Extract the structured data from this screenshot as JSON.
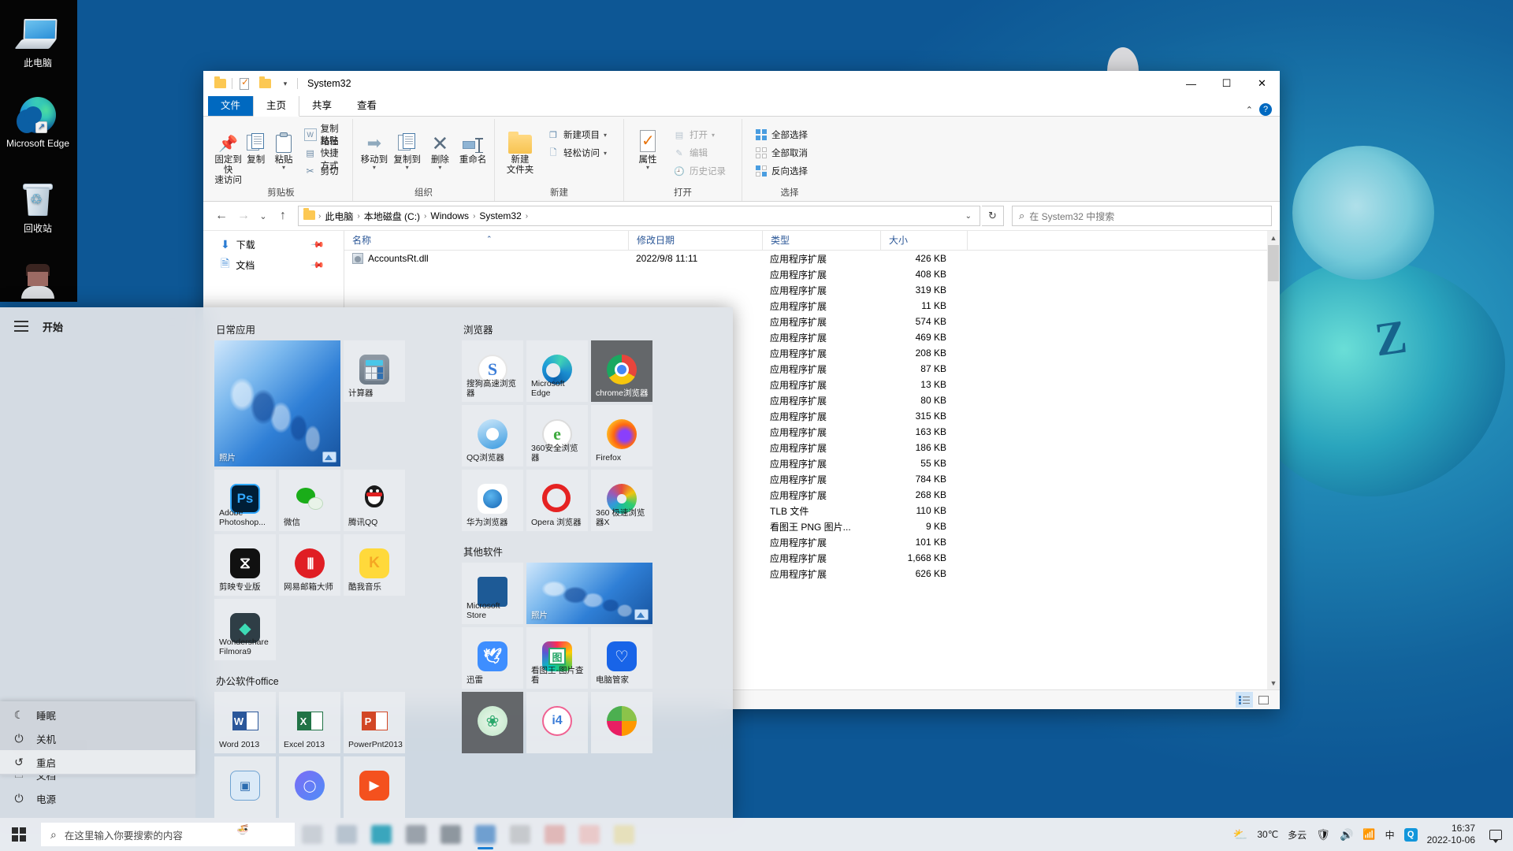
{
  "desktop": {
    "icons": [
      {
        "label": "此电脑",
        "icon": "this-pc-icon"
      },
      {
        "label": "Microsoft Edge",
        "icon": "edge-icon"
      },
      {
        "label": "回收站",
        "icon": "recycle-bin-icon"
      },
      {
        "label": "",
        "icon": "user-avatar-icon"
      }
    ]
  },
  "explorer": {
    "title": "System32",
    "quick_access": [
      "folder-icon",
      "properties-icon",
      "new-folder-icon",
      "customize-caret-icon"
    ],
    "window_buttons": {
      "minimize": "—",
      "maximize": "☐",
      "close": "✕"
    },
    "tabs": [
      {
        "label": "文件",
        "kind": "file"
      },
      {
        "label": "主页",
        "kind": "active"
      },
      {
        "label": "共享",
        "kind": "normal"
      },
      {
        "label": "查看",
        "kind": "normal"
      }
    ],
    "ribbon_collapse": "⌃",
    "help": "?",
    "ribbon": {
      "groups": [
        {
          "label": "剪贴板",
          "big": [
            {
              "label": "固定到快\n速访问",
              "icon": "pin-icon",
              "caret": false
            },
            {
              "label": "复制",
              "icon": "copy-icon",
              "caret": false
            },
            {
              "label": "粘贴",
              "icon": "paste-icon",
              "caret": true
            }
          ],
          "small": [
            {
              "label": "复制路径",
              "icon": "copy-path-icon",
              "dim": false
            },
            {
              "label": "粘贴快捷方式",
              "icon": "paste-shortcut-icon",
              "dim": false
            },
            {
              "label": "剪切",
              "icon": "cut-icon",
              "dim": false
            }
          ]
        },
        {
          "label": "组织",
          "big": [
            {
              "label": "移动到",
              "icon": "move-to-icon",
              "caret": true
            },
            {
              "label": "复制到",
              "icon": "copy-to-icon",
              "caret": true
            },
            {
              "label": "删除",
              "icon": "delete-icon",
              "caret": true
            },
            {
              "label": "重命名",
              "icon": "rename-icon",
              "caret": false
            }
          ],
          "small": []
        },
        {
          "label": "新建",
          "big": [
            {
              "label": "新建\n文件夹",
              "icon": "new-folder-icon",
              "caret": false
            }
          ],
          "small": [
            {
              "label": "新建项目",
              "icon": "new-item-icon",
              "dim": false,
              "caret": true
            },
            {
              "label": "轻松访问",
              "icon": "easy-access-icon",
              "dim": false,
              "caret": true
            }
          ]
        },
        {
          "label": "打开",
          "big": [
            {
              "label": "属性",
              "icon": "properties-icon",
              "caret": true
            }
          ],
          "small": [
            {
              "label": "打开",
              "icon": "open-icon",
              "dim": true,
              "caret": true
            },
            {
              "label": "编辑",
              "icon": "edit-icon",
              "dim": true
            },
            {
              "label": "历史记录",
              "icon": "history-icon",
              "dim": true
            }
          ]
        },
        {
          "label": "选择",
          "big": [],
          "small": [
            {
              "label": "全部选择",
              "icon": "select-all-icon",
              "dim": false
            },
            {
              "label": "全部取消",
              "icon": "select-none-icon",
              "dim": false
            },
            {
              "label": "反向选择",
              "icon": "invert-selection-icon",
              "dim": false
            }
          ]
        }
      ]
    },
    "address": {
      "back": "←",
      "forward": "→",
      "recent": "⌄",
      "up": "↑",
      "crumbs": [
        "此电脑",
        "本地磁盘 (C:)",
        "Windows",
        "System32"
      ],
      "dropdown": "⌄",
      "refresh": "↻"
    },
    "search": {
      "placeholder": "在 System32 中搜索",
      "icon": "search-icon"
    },
    "nav_items": [
      {
        "label": "下载",
        "icon": "downloads-icon",
        "pinned": true
      },
      {
        "label": "文档",
        "icon": "documents-icon",
        "pinned": true
      }
    ],
    "columns": [
      "名称",
      "修改日期",
      "类型",
      "大小"
    ],
    "sort_column": "名称",
    "rows": [
      {
        "name": "AccountsRt.dll",
        "date": "2022/9/8 11:11",
        "type": "应用程序扩展",
        "size": "426 KB"
      },
      {
        "name": "",
        "date": "",
        "type": "应用程序扩展",
        "size": "408 KB"
      },
      {
        "name": "",
        "date": "",
        "type": "应用程序扩展",
        "size": "319 KB"
      },
      {
        "name": "",
        "date": "",
        "type": "应用程序扩展",
        "size": "11 KB"
      },
      {
        "name": "",
        "date": "",
        "type": "应用程序扩展",
        "size": "574 KB"
      },
      {
        "name": "",
        "date": "",
        "type": "应用程序扩展",
        "size": "469 KB"
      },
      {
        "name": "",
        "date": "",
        "type": "应用程序扩展",
        "size": "208 KB"
      },
      {
        "name": "",
        "date": "",
        "type": "应用程序扩展",
        "size": "87 KB"
      },
      {
        "name": "",
        "date": "",
        "type": "应用程序扩展",
        "size": "13 KB"
      },
      {
        "name": "",
        "date": "",
        "type": "应用程序扩展",
        "size": "80 KB"
      },
      {
        "name": "",
        "date": "",
        "type": "应用程序扩展",
        "size": "315 KB"
      },
      {
        "name": "",
        "date": "",
        "type": "应用程序扩展",
        "size": "163 KB"
      },
      {
        "name": "",
        "date": "",
        "type": "应用程序扩展",
        "size": "186 KB"
      },
      {
        "name": "",
        "date": "",
        "type": "应用程序扩展",
        "size": "55 KB"
      },
      {
        "name": "",
        "date": "",
        "type": "应用程序扩展",
        "size": "784 KB"
      },
      {
        "name": "",
        "date": "",
        "type": "应用程序扩展",
        "size": "268 KB"
      },
      {
        "name": "",
        "date": "",
        "type": "TLB 文件",
        "size": "110 KB"
      },
      {
        "name": "",
        "date": "",
        "type": "看图王 PNG 图片...",
        "size": "9 KB"
      },
      {
        "name": "",
        "date": "",
        "type": "应用程序扩展",
        "size": "101 KB"
      },
      {
        "name": "",
        "date": "",
        "type": "应用程序扩展",
        "size": "1,668 KB"
      },
      {
        "name": "",
        "date": "",
        "type": "应用程序扩展",
        "size": "626 KB"
      }
    ],
    "view_buttons": [
      {
        "name": "details-view",
        "active": true
      },
      {
        "name": "large-icons-view",
        "active": false
      }
    ]
  },
  "start_menu": {
    "start_label": "开始",
    "hamburger": "hamburger-icon",
    "links": [
      {
        "label": "文档",
        "icon": "document-icon"
      },
      {
        "label": "电源",
        "icon": "power-icon"
      }
    ],
    "power_flyout": [
      {
        "label": "睡眠",
        "icon": "sleep-moon-icon",
        "highlight": false
      },
      {
        "label": "关机",
        "icon": "shutdown-icon",
        "highlight": false
      },
      {
        "label": "重启",
        "icon": "restart-icon",
        "highlight": true
      }
    ],
    "groups": [
      {
        "title": "日常应用",
        "tiles": [
          {
            "label": "照片",
            "size": "wide",
            "style": "photo",
            "icon": "photos-icon"
          },
          {
            "label": "计算器",
            "size": "small",
            "style": "light",
            "icon": "calculator-icon"
          },
          {
            "label": "Adobe Photoshop...",
            "size": "small",
            "style": "light",
            "icon": "photoshop-icon"
          },
          {
            "label": "微信",
            "size": "small",
            "style": "light",
            "icon": "wechat-icon"
          },
          {
            "label": "腾讯QQ",
            "size": "small",
            "style": "light",
            "icon": "qq-icon"
          },
          {
            "label": "剪映专业版",
            "size": "small",
            "style": "light",
            "icon": "jianying-icon"
          },
          {
            "label": "网易邮箱大师",
            "size": "small",
            "style": "light",
            "icon": "netease-mail-icon"
          },
          {
            "label": "酷我音乐",
            "size": "small",
            "style": "light",
            "icon": "kuwo-music-icon"
          },
          {
            "label": "Wondershare Filmora9",
            "size": "small",
            "style": "light",
            "icon": "filmora-icon"
          }
        ]
      },
      {
        "title": "办公软件office",
        "tiles": [
          {
            "label": "Word 2013",
            "size": "small",
            "style": "light",
            "icon": "word-icon"
          },
          {
            "label": "Excel 2013",
            "size": "small",
            "style": "light",
            "icon": "excel-icon"
          },
          {
            "label": "PowerPnt2013",
            "size": "small",
            "style": "light",
            "icon": "powerpoint-icon"
          },
          {
            "label": "",
            "size": "small",
            "style": "light",
            "icon": "publisher-icon"
          },
          {
            "label": "",
            "size": "small",
            "style": "light",
            "icon": "qq-browser-blue-icon"
          },
          {
            "label": "",
            "size": "small",
            "style": "light",
            "icon": "orange-media-icon"
          }
        ]
      },
      {
        "title": "浏览器",
        "tiles": [
          {
            "label": "搜狗高速浏览器",
            "size": "small",
            "style": "light",
            "icon": "sogou-browser-icon"
          },
          {
            "label": "Microsoft Edge",
            "size": "small",
            "style": "light",
            "icon": "edge-icon"
          },
          {
            "label": "chrome浏览器",
            "size": "small",
            "style": "dark",
            "icon": "chrome-icon"
          },
          {
            "label": "QQ浏览器",
            "size": "small",
            "style": "light",
            "icon": "qq-browser-icon"
          },
          {
            "label": "360安全浏览器",
            "size": "small",
            "style": "light",
            "icon": "360-browser-icon"
          },
          {
            "label": "Firefox",
            "size": "small",
            "style": "light",
            "icon": "firefox-icon"
          },
          {
            "label": "华为浏览器",
            "size": "small",
            "style": "light",
            "icon": "huawei-browser-icon"
          },
          {
            "label": "Opera 浏览器",
            "size": "small",
            "style": "light",
            "icon": "opera-icon"
          },
          {
            "label": "360 极速浏览器X",
            "size": "small",
            "style": "light",
            "icon": "360-speed-browser-icon"
          }
        ]
      },
      {
        "title": "其他软件",
        "tiles": [
          {
            "label": "Microsoft Store",
            "size": "small",
            "style": "light",
            "icon": "microsoft-store-icon"
          },
          {
            "label": "照片",
            "size": "med",
            "style": "photo",
            "icon": "photos-icon"
          },
          {
            "label": "迅雷",
            "size": "small",
            "style": "light",
            "icon": "thunder-icon"
          },
          {
            "label": "看图王-图片查看",
            "size": "small",
            "style": "light",
            "icon": "kantuwang-icon"
          },
          {
            "label": "电脑管家",
            "size": "small",
            "style": "light",
            "icon": "pc-manager-icon"
          },
          {
            "label": "",
            "size": "small",
            "style": "dark",
            "icon": "green-flower-icon"
          },
          {
            "label": "",
            "size": "small",
            "style": "light",
            "icon": "i4-icon"
          },
          {
            "label": "",
            "size": "small",
            "style": "light",
            "icon": "colorful-flower-icon"
          }
        ]
      }
    ]
  },
  "taskbar": {
    "start_button": "windows-logo-icon",
    "search_placeholder": "在这里输入你要搜索的内容",
    "search_icon": "search-icon",
    "apps": [
      {
        "name": "taskbar-app-1",
        "color": "#c9cfd6",
        "open": false
      },
      {
        "name": "taskbar-app-2",
        "color": "#b7c3cf",
        "open": false
      },
      {
        "name": "taskbar-app-3",
        "color": "#3aa6bd",
        "open": false
      },
      {
        "name": "taskbar-app-4",
        "color": "#9aa2ab",
        "open": false
      },
      {
        "name": "taskbar-app-5",
        "color": "#8e979f",
        "open": false
      },
      {
        "name": "taskbar-app-6",
        "color": "#6f9fd0",
        "open": true
      },
      {
        "name": "taskbar-app-7",
        "color": "#c6c9cd",
        "open": false
      },
      {
        "name": "taskbar-app-8",
        "color": "#e0b8b8",
        "open": false
      },
      {
        "name": "taskbar-app-9",
        "color": "#e9c9c9",
        "open": false
      },
      {
        "name": "taskbar-app-10",
        "color": "#e6e0bb",
        "open": false
      }
    ],
    "tray": {
      "weather_icon": "partly-cloudy-icon",
      "temperature": "30℃",
      "weather_text": "多云",
      "icons": [
        "security-shield-icon",
        "volume-icon",
        "wifi-icon",
        "ime-chinese-icon",
        "qq-tray-icon"
      ],
      "ime_label": "中",
      "time": "16:37",
      "date": "2022-10-06",
      "notification_icon": "notification-icon"
    }
  },
  "colors": {
    "accent": "#0069c0",
    "desktop_blue": "#0b5fa4",
    "ribbon_bg": "#f7f7f7",
    "selected_tile": "#5a5c5f",
    "taskbar_bg": "#eef0f3"
  }
}
